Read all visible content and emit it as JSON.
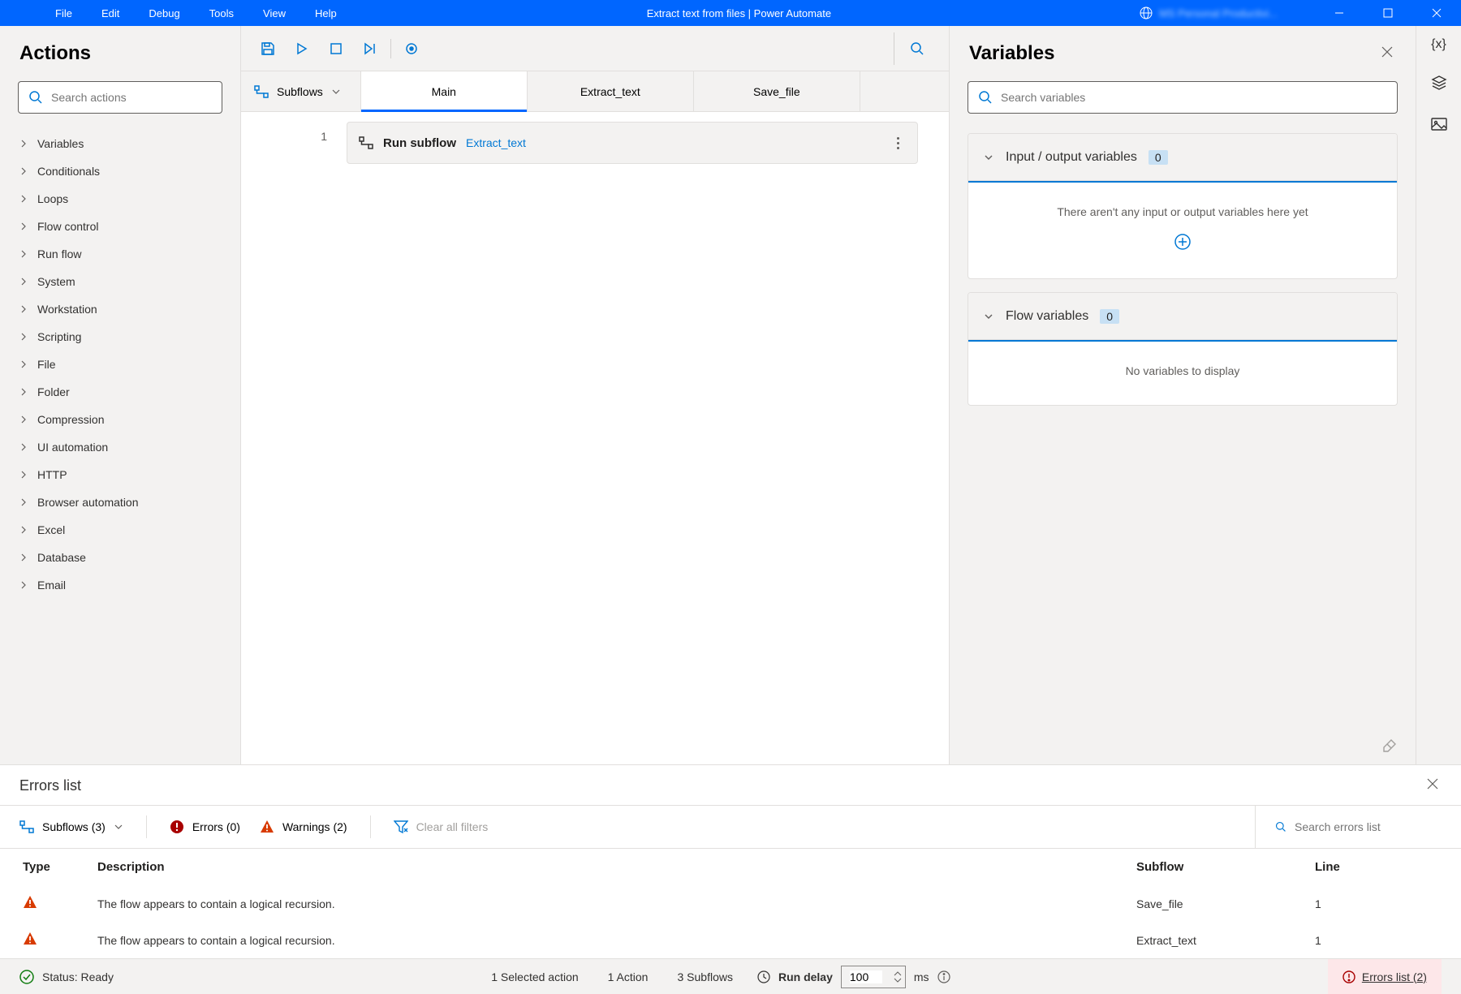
{
  "titlebar": {
    "menus": [
      "File",
      "Edit",
      "Debug",
      "Tools",
      "View",
      "Help"
    ],
    "title": "Extract text from files | Power Automate",
    "account_blurred_text": "MS Personal Productivi..."
  },
  "actions_panel": {
    "title": "Actions",
    "search_placeholder": "Search actions",
    "categories": [
      "Variables",
      "Conditionals",
      "Loops",
      "Flow control",
      "Run flow",
      "System",
      "Workstation",
      "Scripting",
      "File",
      "Folder",
      "Compression",
      "UI automation",
      "HTTP",
      "Browser automation",
      "Excel",
      "Database",
      "Email"
    ]
  },
  "editor": {
    "subflows_label": "Subflows",
    "tabs": [
      "Main",
      "Extract_text",
      "Save_file"
    ],
    "active_tab": 0,
    "line": "1",
    "action_title": "Run subflow",
    "action_ref": "Extract_text"
  },
  "variables_panel": {
    "title": "Variables",
    "search_placeholder": "Search variables",
    "io_title": "Input / output variables",
    "io_count": "0",
    "io_empty": "There aren't any input or output variables here yet",
    "flow_title": "Flow variables",
    "flow_count": "0",
    "flow_empty": "No variables to display"
  },
  "errors_panel": {
    "title": "Errors list",
    "subflows_filter": "Subflows (3)",
    "errors_filter": "Errors (0)",
    "warnings_filter": "Warnings (2)",
    "clear_filters": "Clear all filters",
    "search_placeholder": "Search errors list",
    "columns": {
      "type": "Type",
      "desc": "Description",
      "sub": "Subflow",
      "line": "Line"
    },
    "rows": [
      {
        "desc": "The flow appears to contain a logical recursion.",
        "sub": "Save_file",
        "line": "1"
      },
      {
        "desc": "The flow appears to contain a logical recursion.",
        "sub": "Extract_text",
        "line": "1"
      }
    ]
  },
  "statusbar": {
    "status": "Status: Ready",
    "selected": "1 Selected action",
    "actions": "1 Action",
    "subflows": "3 Subflows",
    "delay_label": "Run delay",
    "delay_value": "100",
    "delay_unit": "ms",
    "errors_link": "Errors list (2)"
  }
}
